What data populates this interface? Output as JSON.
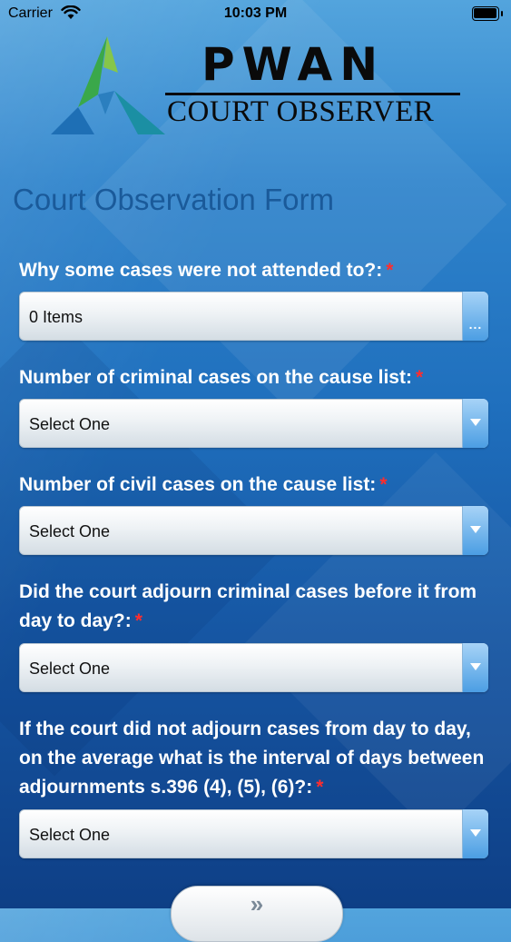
{
  "statusbar": {
    "carrier": "Carrier",
    "time": "10:03 PM"
  },
  "logo": {
    "title": "PWAN",
    "subtitle": "COURT OBSERVER"
  },
  "form": {
    "title": "Court Observation Form",
    "required_mark": "*",
    "fields": [
      {
        "label": "Why some cases were not attended to?:",
        "value": "0 Items",
        "control": "multi-select"
      },
      {
        "label": "Number of criminal cases on the cause list:",
        "value": "Select One",
        "control": "dropdown"
      },
      {
        "label": "Number of civil cases on the cause list:",
        "value": "Select One",
        "control": "dropdown"
      },
      {
        "label": "Did the court adjourn criminal cases before it from day to day?:",
        "value": "Select One",
        "control": "dropdown"
      },
      {
        "label": "If the court did not adjourn cases from day to day, on the average what is the interval of days between adjournments s.396 (4), (5), (6)?:",
        "value": "Select One",
        "control": "dropdown"
      }
    ]
  },
  "icons": {
    "wifi": "wifi-icon",
    "battery": "battery-icon",
    "multi_select": "ellipsis-icon",
    "dropdown": "chevron-down-icon",
    "next": "double-chevron-icon"
  },
  "next_button": {
    "label": "»"
  },
  "colors": {
    "title": "#1a5a9a",
    "required": "#ff2d2d",
    "logo_green": "#3aa84a",
    "logo_blue": "#1e6fb5",
    "logo_teal": "#1b8fa3"
  }
}
